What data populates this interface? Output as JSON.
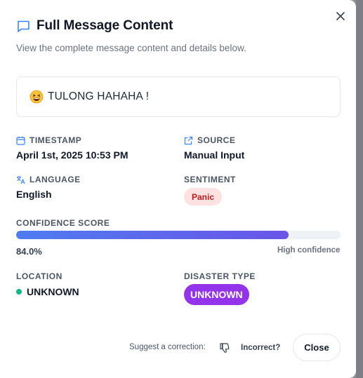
{
  "dialog": {
    "title": "Full Message Content",
    "subtitle": "View the complete message content and details below.",
    "close_icon": "close-icon"
  },
  "message": {
    "emoji_icon": "grinning-squinting-face-icon",
    "text": "TULONG HAHAHA !"
  },
  "timestamp": {
    "label": "TIMESTAMP",
    "value": "April 1st, 2025 10:53 PM",
    "icon": "calendar-icon"
  },
  "source": {
    "label": "SOURCE",
    "value": "Manual Input",
    "icon": "external-link-icon"
  },
  "language": {
    "label": "LANGUAGE",
    "value": "English",
    "icon": "translate-icon"
  },
  "sentiment": {
    "label": "SENTIMENT",
    "value": "Panic",
    "badge_bg": "#fee2e2",
    "badge_fg": "#b91c1c"
  },
  "confidence": {
    "label": "CONFIDENCE SCORE",
    "percent_text": "84.0%",
    "fraction": 0.84,
    "note": "High confidence"
  },
  "location": {
    "label": "LOCATION",
    "value": "UNKNOWN",
    "dot_color": "#10b981"
  },
  "disaster_type": {
    "label": "DISASTER TYPE",
    "value": "UNKNOWN",
    "badge_bg": "#9333ea"
  },
  "footer": {
    "suggest_text": "Suggest a correction:",
    "incorrect_label": "Incorrect?",
    "incorrect_icon": "thumbs-down-icon",
    "close_label": "Close"
  },
  "colors": {
    "accent": "#3b82f6"
  }
}
